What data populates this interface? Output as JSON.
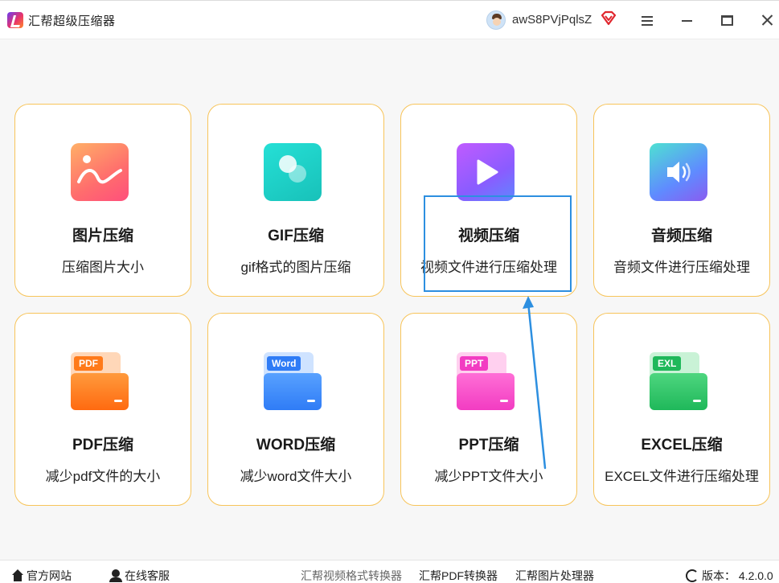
{
  "app": {
    "title": "汇帮超级压缩器",
    "username": "awS8PVjPqlsZ"
  },
  "cards": [
    {
      "name": "图片压缩",
      "desc": "压缩图片大小",
      "icon": "image-icon"
    },
    {
      "name": "GIF压缩",
      "desc": "gif格式的图片压缩",
      "icon": "gif-icon"
    },
    {
      "name": "视频压缩",
      "desc": "视频文件进行压缩处理",
      "icon": "video-play-icon"
    },
    {
      "name": "音频压缩",
      "desc": "音频文件进行压缩处理",
      "icon": "speaker-icon"
    },
    {
      "name": "PDF压缩",
      "desc": "减少pdf文件的大小",
      "icon": "pdf-folder-icon",
      "tag": "PDF"
    },
    {
      "name": "WORD压缩",
      "desc": "减少word文件大小",
      "icon": "word-folder-icon",
      "tag": "Word"
    },
    {
      "name": "PPT压缩",
      "desc": "减少PPT文件大小",
      "icon": "ppt-folder-icon",
      "tag": "PPT"
    },
    {
      "name": "EXCEL压缩",
      "desc": "EXCEL文件进行压缩处理",
      "icon": "excel-folder-icon",
      "tag": "EXL"
    }
  ],
  "footer": {
    "website": "官方网站",
    "service": "在线客服",
    "link1": "汇帮视频格式转换器",
    "link2": "汇帮PDF转换器",
    "link3": "汇帮图片处理器",
    "version": "版本： 4.2.0.0"
  },
  "colors": {
    "card_border": "#f7c45a",
    "highlight": "#2d8fe0"
  }
}
